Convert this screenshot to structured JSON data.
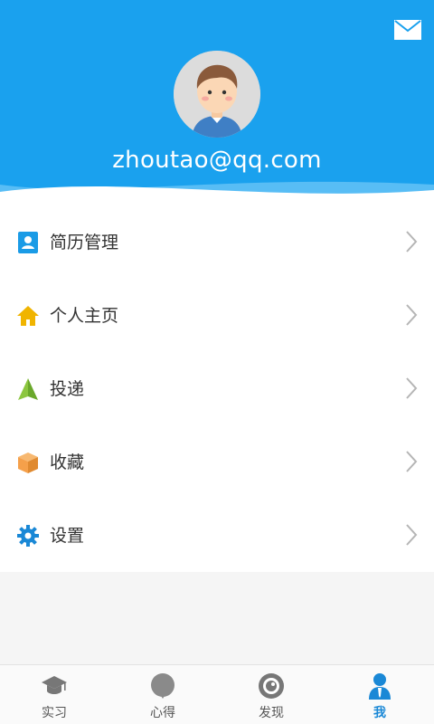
{
  "header": {
    "email": "zhoutao@qq.com",
    "mail_icon": "envelope-icon",
    "avatar_icon": "boy-avatar",
    "bg_color": "#1aa1ee"
  },
  "menu": {
    "items": [
      {
        "label": "简历管理",
        "icon": "resume-icon",
        "color": "#1a9be6"
      },
      {
        "label": "个人主页",
        "icon": "home-icon",
        "color": "#f0b400"
      },
      {
        "label": "投递",
        "icon": "paper-plane-icon",
        "color": "#8cc63f"
      },
      {
        "label": "收藏",
        "icon": "box-icon",
        "color": "#f5a04a"
      },
      {
        "label": "设置",
        "icon": "gear-icon",
        "color": "#1a88d6"
      }
    ]
  },
  "tabbar": {
    "active_index": 3,
    "active_color": "#1a88d6",
    "tabs": [
      {
        "label": "实习",
        "icon": "graduation-cap-icon"
      },
      {
        "label": "心得",
        "icon": "balloon-icon"
      },
      {
        "label": "发现",
        "icon": "eye-icon"
      },
      {
        "label": "我",
        "icon": "person-icon"
      }
    ]
  }
}
